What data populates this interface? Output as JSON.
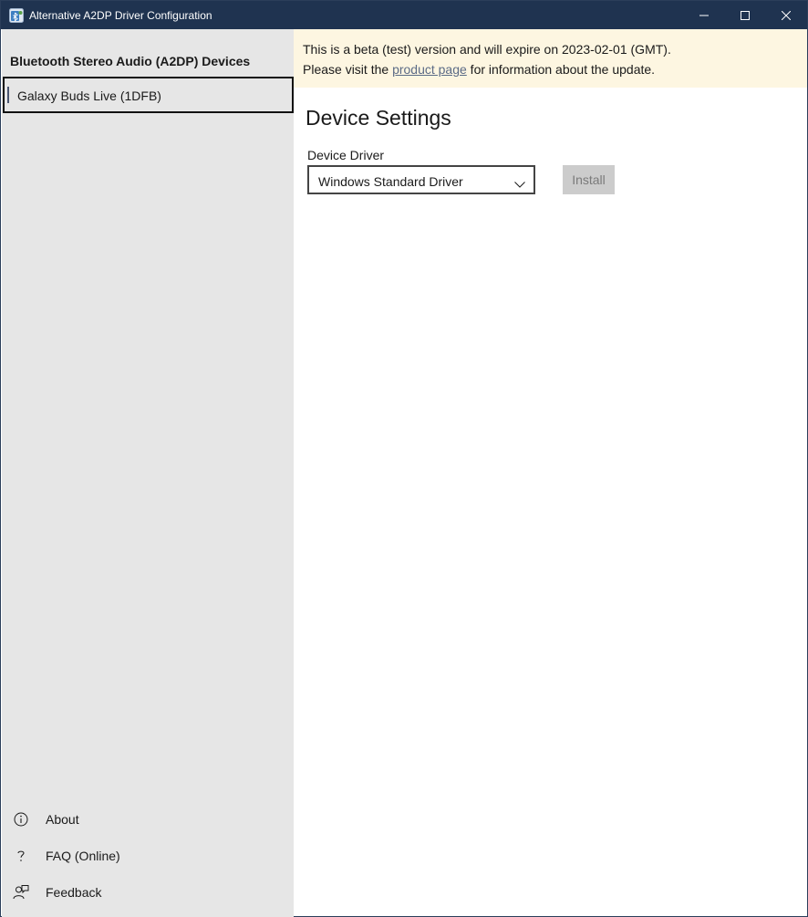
{
  "window": {
    "title": "Alternative A2DP Driver Configuration",
    "app_icon": "bluetooth-config-icon",
    "controls": [
      "minimize-icon",
      "maximize-icon",
      "close-icon"
    ]
  },
  "sidebar": {
    "heading": "Bluetooth Stereo Audio (A2DP) Devices",
    "devices": [
      {
        "label": "Galaxy Buds Live (1DFB)",
        "selected": true
      }
    ],
    "footer_items": [
      {
        "label": "About",
        "icon": "info-icon"
      },
      {
        "label": "FAQ (Online)",
        "icon": "question-icon"
      },
      {
        "label": "Feedback",
        "icon": "feedback-icon"
      }
    ]
  },
  "banner": {
    "line1": "This is a beta (test) version and will expire on 2023-02-01 (GMT).",
    "line2_prefix": "Please visit the ",
    "link_text": "product page",
    "line2_suffix": " for information about the update."
  },
  "main": {
    "title": "Device Settings",
    "driver_label": "Device Driver",
    "driver_selected": "Windows Standard Driver",
    "install_label": "Install",
    "install_enabled": false
  },
  "colors": {
    "titlebar": "#1f3350",
    "sidebar": "#e6e6e6",
    "banner": "#fdf6e1",
    "link": "#5b6b86",
    "button_disabled": "#cccccc"
  }
}
